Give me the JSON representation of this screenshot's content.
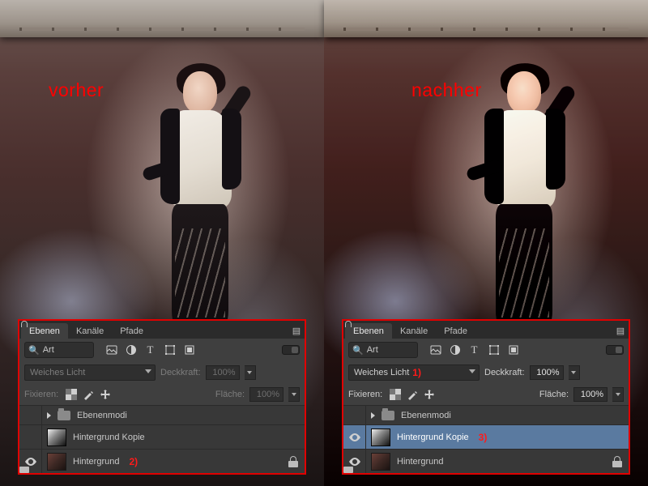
{
  "left": {
    "label": "vorher",
    "panel": {
      "tabs": {
        "layers": "Ebenen",
        "channels": "Kanäle",
        "paths": "Pfade"
      },
      "filter_kind": "Art",
      "blend_mode": "Weiches Licht",
      "blend_annotation": "",
      "opacity_label": "Deckkraft:",
      "opacity_value": "100%",
      "lock_label": "Fixieren:",
      "fill_label": "Fläche:",
      "fill_value": "100%",
      "layers": {
        "group": "Ebenenmodi",
        "copy": "Hintergrund Kopie",
        "copy_annotation": "",
        "bg": "Hintergrund",
        "bg_annotation": "2)"
      }
    }
  },
  "right": {
    "label": "nachher",
    "panel": {
      "tabs": {
        "layers": "Ebenen",
        "channels": "Kanäle",
        "paths": "Pfade"
      },
      "filter_kind": "Art",
      "blend_mode": "Weiches Licht",
      "blend_annotation": "1)",
      "opacity_label": "Deckkraft:",
      "opacity_value": "100%",
      "lock_label": "Fixieren:",
      "fill_label": "Fläche:",
      "fill_value": "100%",
      "layers": {
        "group": "Ebenenmodi",
        "copy": "Hintergrund Kopie",
        "copy_annotation": "3)",
        "bg": "Hintergrund",
        "bg_annotation": ""
      }
    }
  },
  "icons": {
    "pixel": "image-icon",
    "adjust": "adjust-icon",
    "type": "type-icon",
    "shape": "shape-icon",
    "smart": "smart-object-icon"
  }
}
